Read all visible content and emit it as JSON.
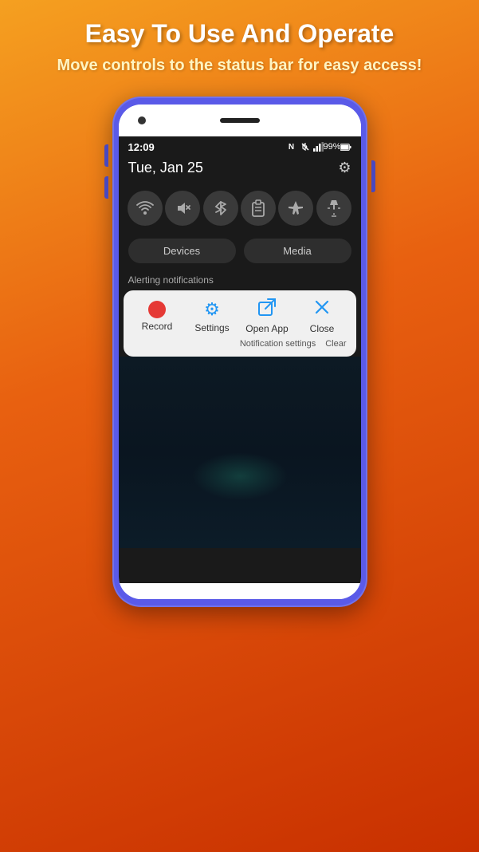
{
  "header": {
    "main_title": "Easy To Use And Operate",
    "sub_title": "Move controls to the status bar for easy access!"
  },
  "phone": {
    "status_bar": {
      "time": "12:09",
      "battery": "99%",
      "battery_icon": "🔋",
      "signal_icon": "📶",
      "nfc_icon": "N",
      "mute_icon": "🔕"
    },
    "date_row": {
      "date": "Tue, Jan 25",
      "settings_icon": "⚙"
    },
    "quick_toggles": [
      {
        "icon": "📶",
        "label": "wifi",
        "unicode": "⊙"
      },
      {
        "icon": "🔕",
        "label": "mute",
        "unicode": "✕"
      },
      {
        "icon": "🔵",
        "label": "bluetooth",
        "unicode": "⚡"
      },
      {
        "icon": "📋",
        "label": "clipboard",
        "unicode": "⊡"
      },
      {
        "icon": "✈",
        "label": "airplane",
        "unicode": "✈"
      },
      {
        "icon": "🔦",
        "label": "flashlight",
        "unicode": "⚡"
      }
    ],
    "devices_media": {
      "devices_label": "Devices",
      "media_label": "Media"
    },
    "notification": {
      "alerting_label": "Alerting notifications",
      "actions": [
        {
          "label": "Record",
          "type": "record"
        },
        {
          "label": "Settings",
          "type": "settings"
        },
        {
          "label": "Open App",
          "type": "open_app"
        },
        {
          "label": "Close",
          "type": "close"
        }
      ],
      "bottom": {
        "settings_link": "Notification settings",
        "clear_link": "Clear"
      }
    }
  }
}
